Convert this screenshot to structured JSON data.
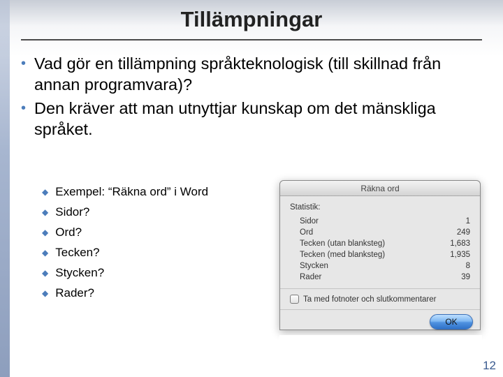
{
  "title": "Tillämpningar",
  "bullets": [
    "Vad gör en tillämpning språkteknologisk (till skillnad från annan programvara)?",
    "Den kräver att man utnyttjar kunskap om det mänskliga språket."
  ],
  "subbullets": [
    "Exempel: “Räkna ord” i Word",
    "Sidor?",
    "Ord?",
    "Tecken?",
    "Stycken?",
    "Rader?"
  ],
  "dialog": {
    "title": "Räkna ord",
    "stats_heading": "Statistik:",
    "rows": [
      {
        "label": "Sidor",
        "value": "1"
      },
      {
        "label": "Ord",
        "value": "249"
      },
      {
        "label": "Tecken (utan blanksteg)",
        "value": "1,683"
      },
      {
        "label": "Tecken (med blanksteg)",
        "value": "1,935"
      },
      {
        "label": "Stycken",
        "value": "8"
      },
      {
        "label": "Rader",
        "value": "39"
      }
    ],
    "checkbox_label": "Ta med fotnoter och slutkommentarer",
    "ok_label": "OK"
  },
  "page_number": "12"
}
